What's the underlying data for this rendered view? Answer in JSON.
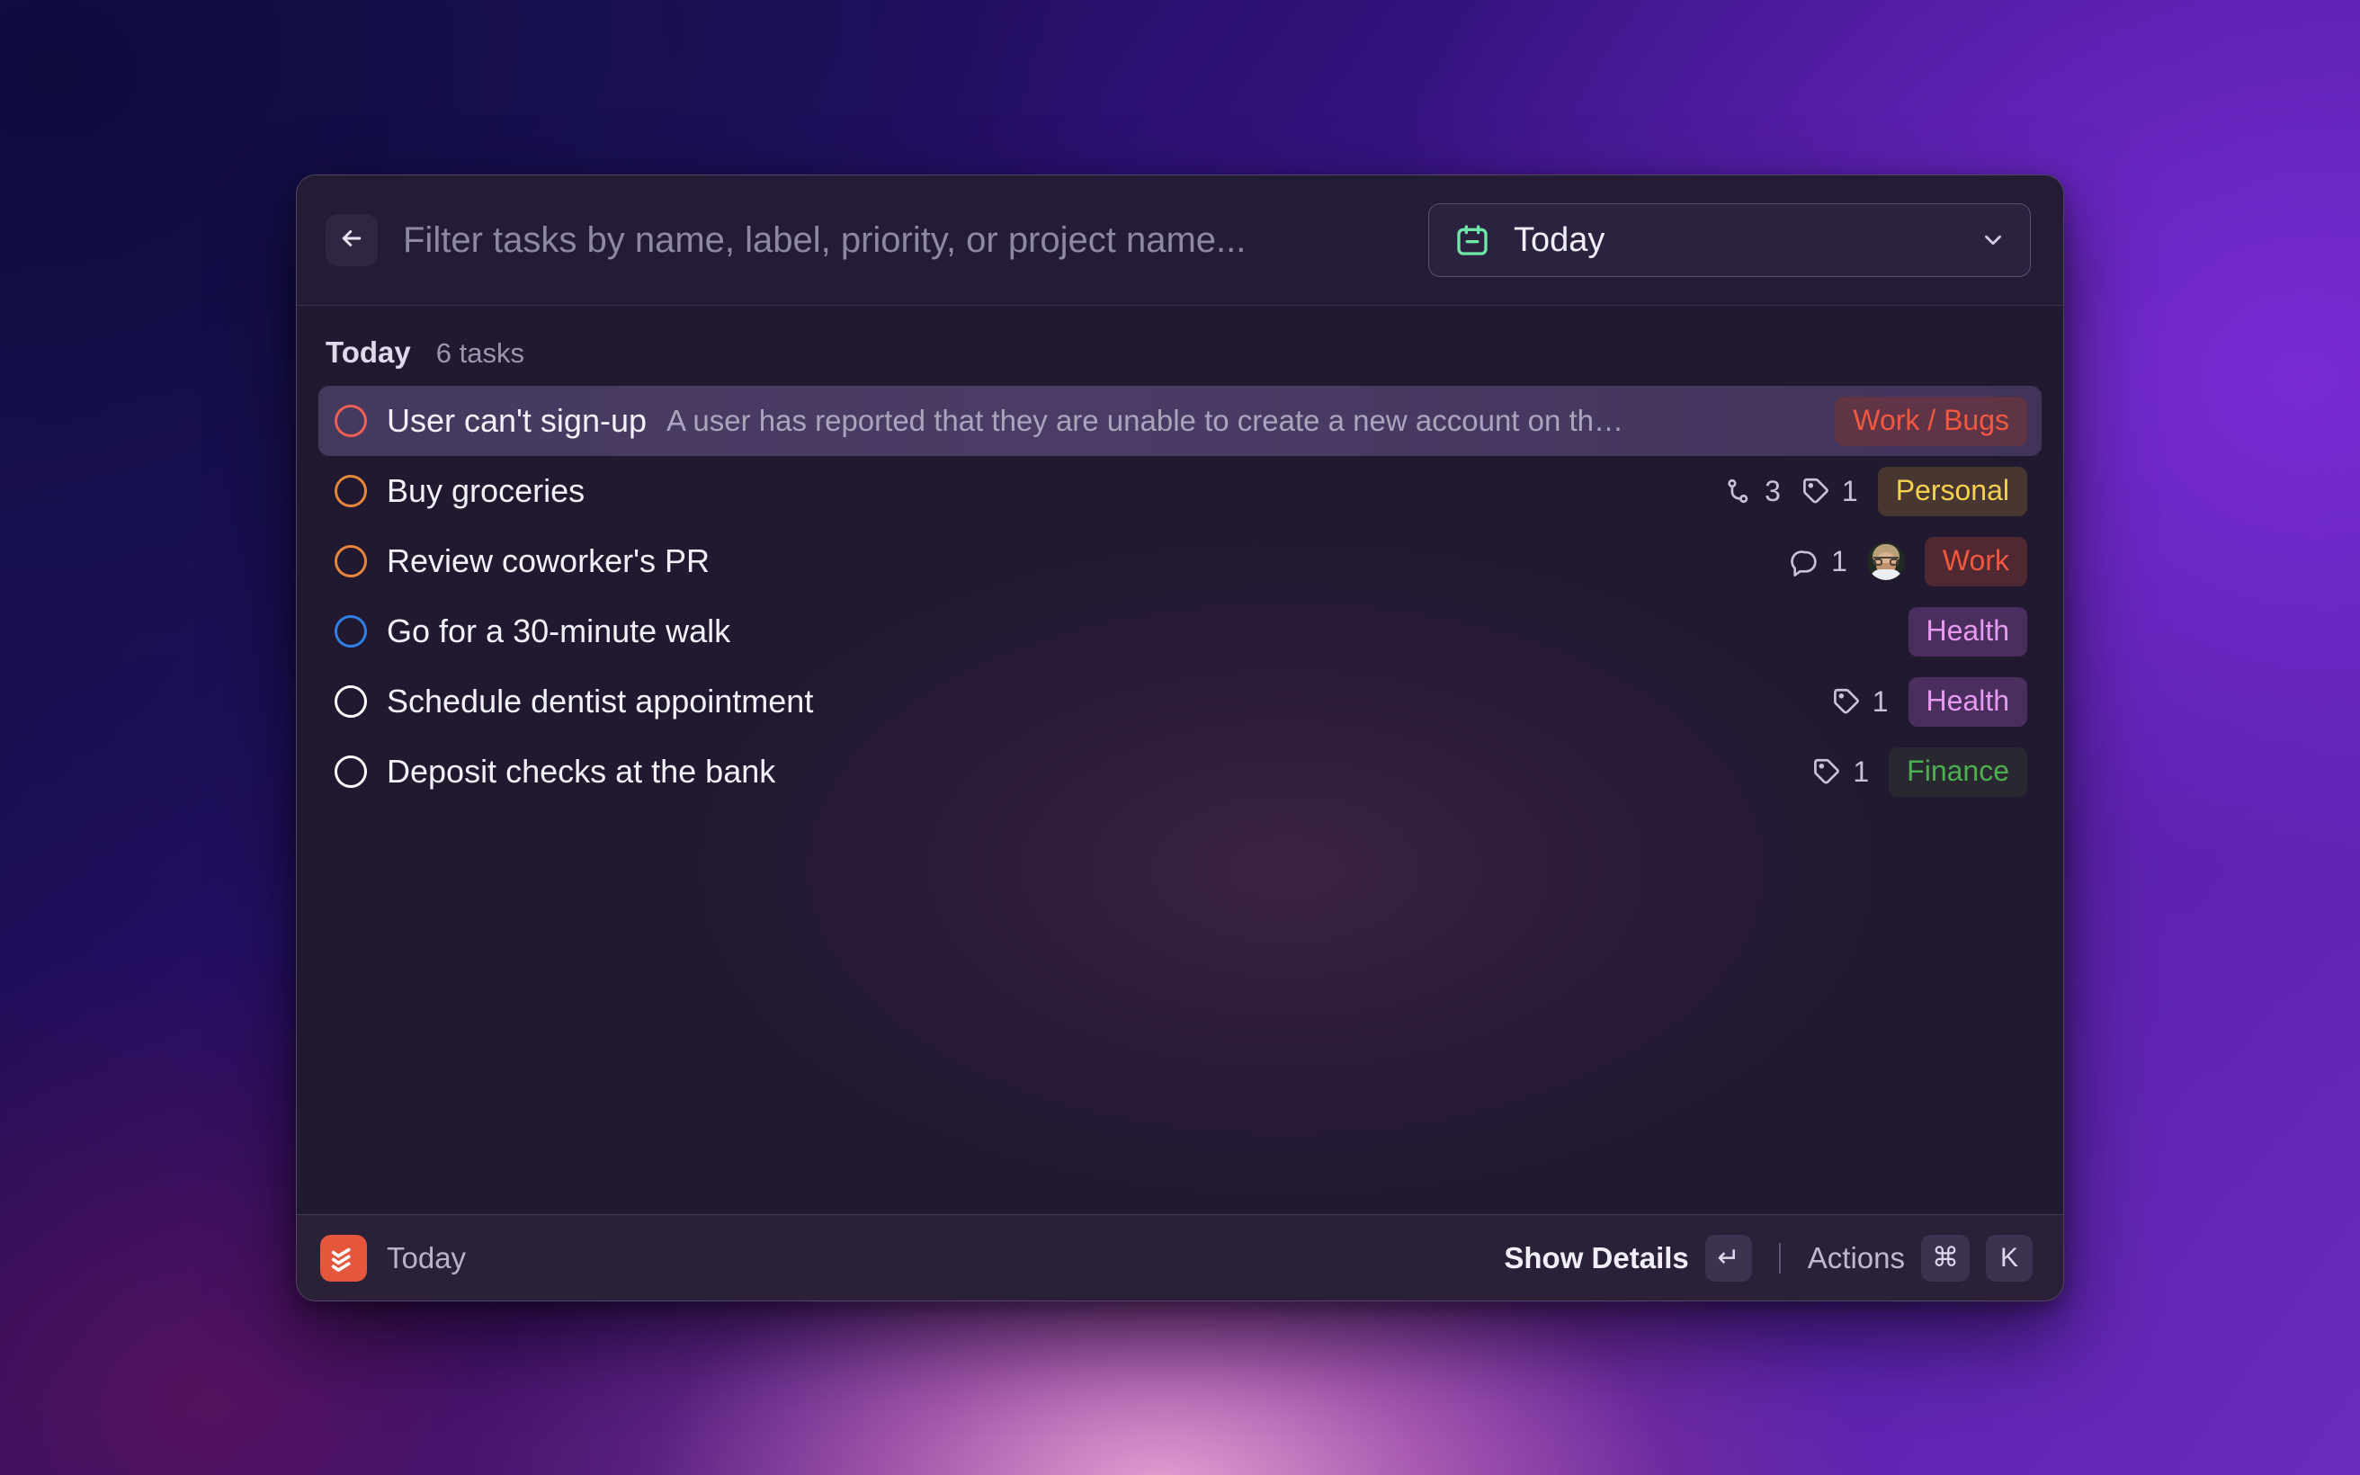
{
  "search": {
    "placeholder": "Filter tasks by name, label, priority, or project name...",
    "value": "",
    "back_icon": "arrow-left-icon"
  },
  "date_filter": {
    "icon": "calendar-today-icon",
    "label": "Today",
    "chevron": "chevron-down-icon",
    "icon_color": "#6ee7a8"
  },
  "group": {
    "title": "Today",
    "count_label": "6 tasks"
  },
  "tasks": [
    {
      "title": "User can't sign-up",
      "description": "A user has reported that they are unable to create a new account on th…",
      "priority": "p1",
      "priority_color": "#ee5f56",
      "selected": true,
      "subtask_count": "",
      "label_count": "",
      "comment_count": "",
      "assignee": false,
      "badge": "Work / Bugs",
      "badge_kind": "work"
    },
    {
      "title": "Buy groceries",
      "description": "",
      "priority": "p2",
      "priority_color": "#e8873c",
      "selected": false,
      "subtask_count": "3",
      "label_count": "1",
      "comment_count": "",
      "assignee": false,
      "badge": "Personal",
      "badge_kind": "personal"
    },
    {
      "title": "Review coworker's PR",
      "description": "",
      "priority": "p2",
      "priority_color": "#e8873c",
      "selected": false,
      "subtask_count": "",
      "label_count": "",
      "comment_count": "1",
      "assignee": true,
      "badge": "Work",
      "badge_kind": "work"
    },
    {
      "title": "Go for a 30-minute walk",
      "description": "",
      "priority": "p3",
      "priority_color": "#2f7fe8",
      "selected": false,
      "subtask_count": "",
      "label_count": "",
      "comment_count": "",
      "assignee": false,
      "badge": "Health",
      "badge_kind": "health"
    },
    {
      "title": "Schedule dentist appointment",
      "description": "",
      "priority": "p4",
      "priority_color": "#ffffff",
      "selected": false,
      "subtask_count": "",
      "label_count": "1",
      "comment_count": "",
      "assignee": false,
      "badge": "Health",
      "badge_kind": "health"
    },
    {
      "title": "Deposit checks at the bank",
      "description": "",
      "priority": "p4",
      "priority_color": "#ffffff",
      "selected": false,
      "subtask_count": "",
      "label_count": "1",
      "comment_count": "",
      "assignee": false,
      "badge": "Finance",
      "badge_kind": "finance"
    }
  ],
  "footer": {
    "logo": "todoist-logo-icon",
    "logo_color": "#e4573d",
    "context": "Today",
    "show_details_label": "Show Details",
    "enter_key": "↵",
    "actions_label": "Actions",
    "cmd_key": "⌘",
    "k_key": "K"
  }
}
